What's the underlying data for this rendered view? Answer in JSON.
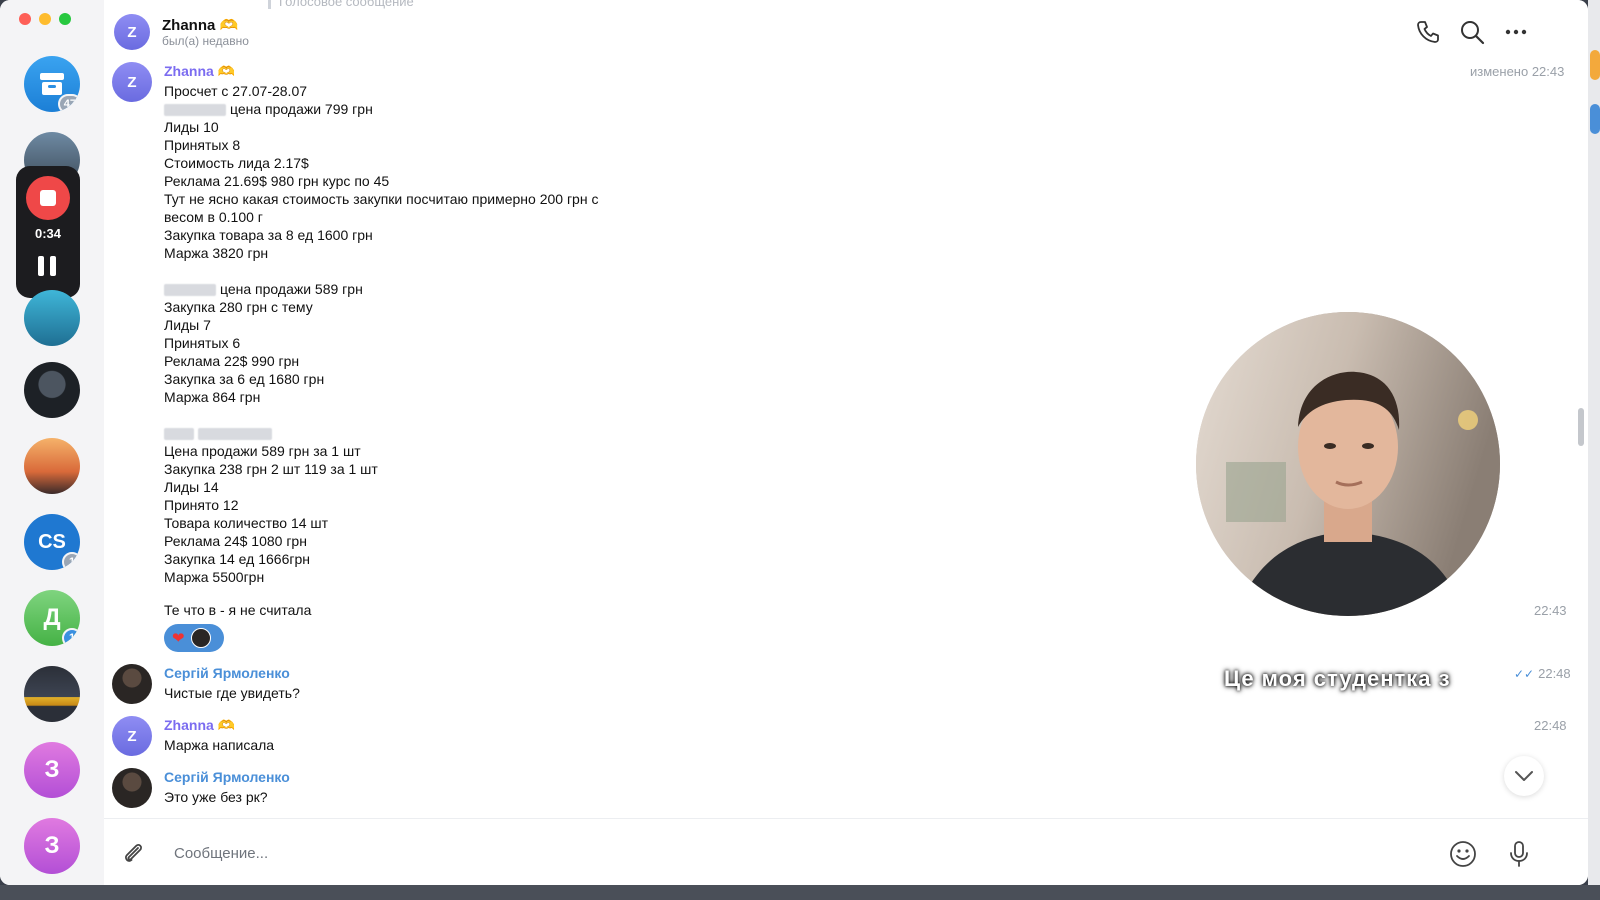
{
  "window": {
    "colors": {
      "close": "#fe5f57",
      "minimize": "#febc2e",
      "zoom": "#28c840",
      "accent_author_z": "#7b6cf0",
      "accent_author_s": "#4a8fd8"
    }
  },
  "sidebar": {
    "chats": [
      {
        "kind": "archive",
        "badge": "47"
      },
      {
        "kind": "photo-group"
      },
      {
        "kind": "photo-pool"
      },
      {
        "kind": "photo-person"
      },
      {
        "kind": "photo-sunset"
      },
      {
        "kind": "logo",
        "text": "CS",
        "badge": "1"
      },
      {
        "kind": "letter",
        "text": "Д",
        "badge": "1"
      },
      {
        "kind": "photo-car"
      },
      {
        "kind": "letter",
        "text": "З"
      },
      {
        "kind": "letter",
        "text": "З"
      }
    ],
    "recorder": {
      "time": "0:34"
    }
  },
  "header": {
    "avatar_letter": "Z",
    "name": "Zhanna 🫶",
    "status": "был(а) недавно",
    "faded_reply": "Голосовое сообщение"
  },
  "messages": {
    "m1": {
      "avatar": "Z",
      "author": "Zhanna 🫶",
      "time": "изменено 22:43",
      "lines": [
        "Просчет с 27.07-28.07",
        "цена продажи 799 грн",
        "Лиды 10",
        "Принятых 8",
        "Стоимость лида 2.17$",
        "Реклама 21.69$ 980 грн курс по 45",
        "Тут не ясно какая стоимость закупки посчитаю примерно 200 грн с",
        "весом в 0.100 г",
        "Закупка товара за 8 ед 1600 грн",
        "Маржа 3820 грн",
        "цена продажи 589 грн",
        "Закупка 280 грн с тему",
        "Лиды 7",
        "Принятых 6",
        "Реклама 22$ 990 грн",
        "Закупка за 6 ед 1680 грн",
        "Маржа 864 грн",
        "Цена продажи 589 грн за 1 шт",
        "Закупка 238 грн 2 шт 119 за 1 шт",
        "Лиды 14",
        "Принято 12",
        "Товара количество 14 шт",
        "Реклама 24$ 1080 грн",
        "Закупка 14 ед 1666грн",
        "Маржа 5500грн",
        "Те что в - я не считала"
      ],
      "time2": "22:43",
      "reaction": "❤"
    },
    "m2": {
      "author": "Сергій Ярмоленко",
      "text": "Чистые где увидеть?",
      "time": "22:48",
      "checks": "✓✓"
    },
    "m3": {
      "avatar": "Z",
      "author": "Zhanna 🫶",
      "text": "Маржа написала",
      "time": "22:48"
    },
    "m4": {
      "author": "Сергій Ярмоленко",
      "text": "Это уже без рк?",
      "checks": "✓✓"
    }
  },
  "video_note": {
    "subtitle": "Це моя студентка з"
  },
  "composer": {
    "placeholder": "Сообщение..."
  }
}
